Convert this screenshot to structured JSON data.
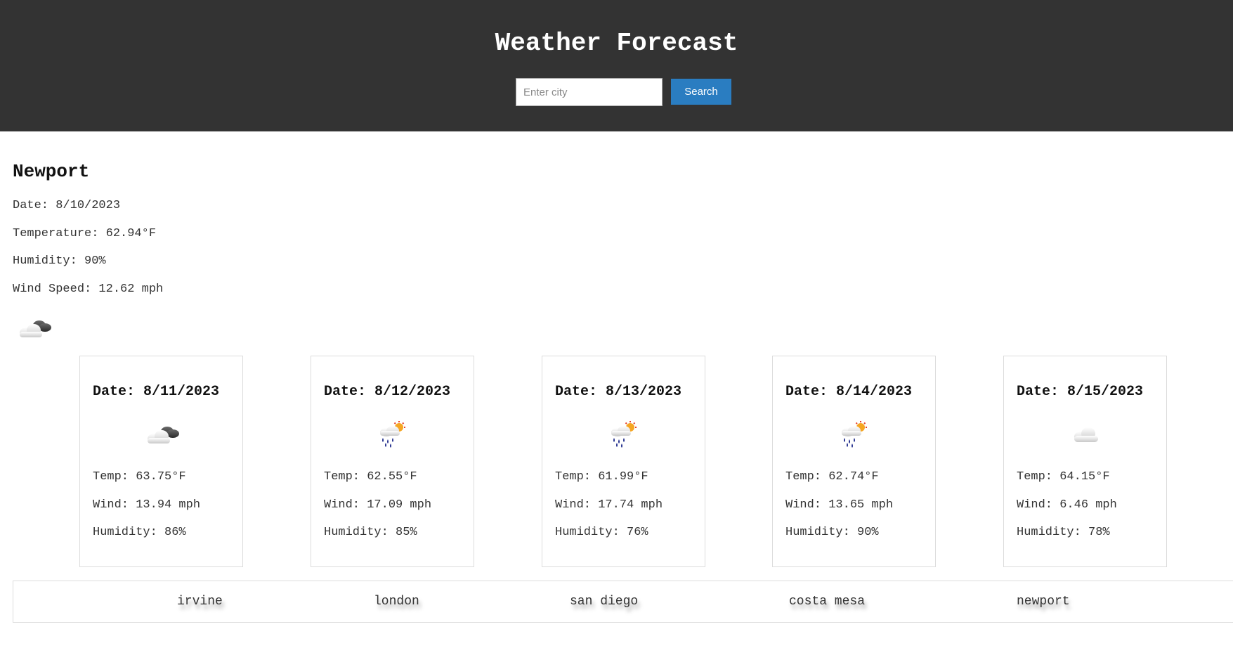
{
  "header": {
    "title": "Weather Forecast",
    "search_placeholder": "Enter city",
    "search_value": "",
    "search_label": "Search"
  },
  "current": {
    "city": "Newport",
    "date": "Date: 8/10/2023",
    "temperature": "Temperature: 62.94°F",
    "humidity": "Humidity: 90%",
    "wind": "Wind Speed: 12.62 mph",
    "icon": "partly-cloudy-icon"
  },
  "forecast": [
    {
      "date": "Date: 8/11/2023",
      "icon": "partly-cloudy-icon",
      "temp": "Temp: 63.75°F",
      "wind": "Wind: 13.94 mph",
      "humidity": "Humidity: 86%"
    },
    {
      "date": "Date: 8/12/2023",
      "icon": "rain-sun-icon",
      "temp": "Temp: 62.55°F",
      "wind": "Wind: 17.09 mph",
      "humidity": "Humidity: 85%"
    },
    {
      "date": "Date: 8/13/2023",
      "icon": "rain-sun-icon",
      "temp": "Temp: 61.99°F",
      "wind": "Wind: 17.74 mph",
      "humidity": "Humidity: 76%"
    },
    {
      "date": "Date: 8/14/2023",
      "icon": "rain-sun-icon",
      "temp": "Temp: 62.74°F",
      "wind": "Wind: 13.65 mph",
      "humidity": "Humidity: 90%"
    },
    {
      "date": "Date: 8/15/2023",
      "icon": "cloud-icon",
      "temp": "Temp: 64.15°F",
      "wind": "Wind: 6.46 mph",
      "humidity": "Humidity: 78%"
    }
  ],
  "history": [
    "irvine",
    "london",
    "san diego",
    "costa mesa",
    "newport"
  ],
  "colors": {
    "header_bg": "#333333",
    "button_bg": "#2a7dc1",
    "card_border": "#dcdcdc"
  }
}
